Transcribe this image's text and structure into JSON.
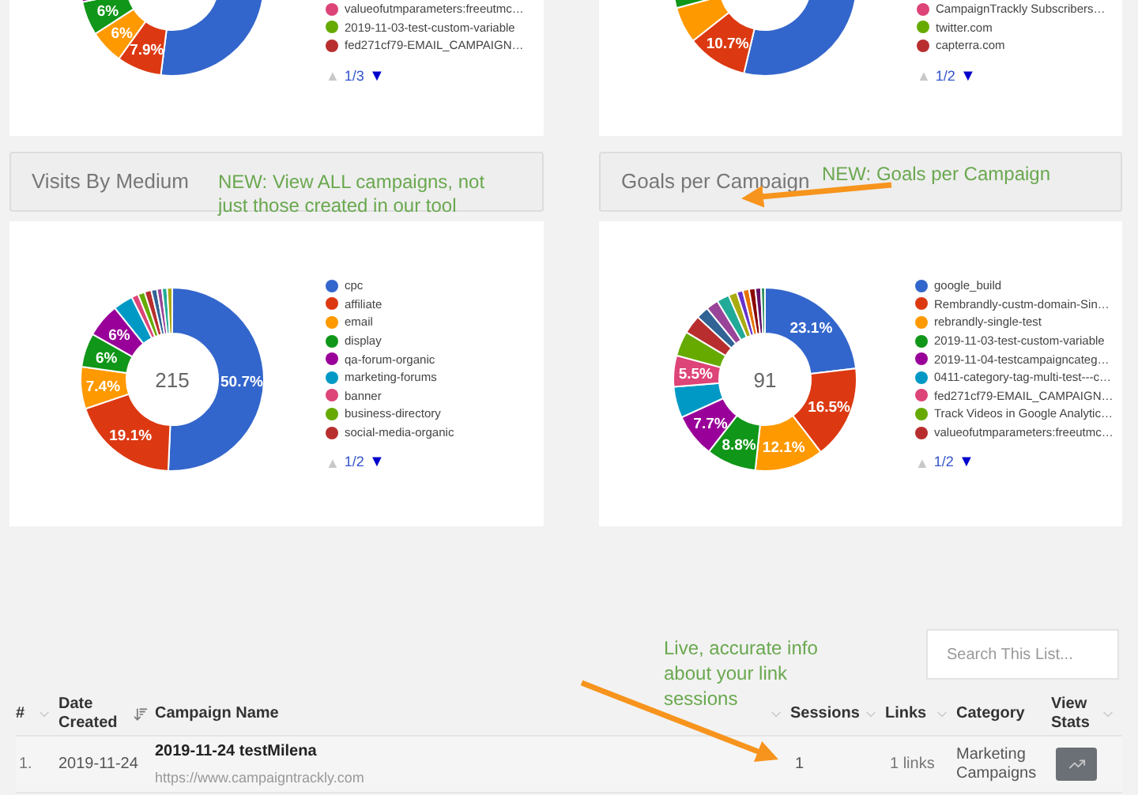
{
  "top_charts": [
    {
      "slice_labels": [
        "6%",
        "6%",
        "7.9%"
      ],
      "legend": [
        {
          "label": "valueofutmparameters:freeutmc…",
          "color": "#dd4477"
        },
        {
          "label": "2019-11-03-test-custom-variable",
          "color": "#66aa00"
        },
        {
          "label": "fed271cf79-EMAIL_CAMPAIGN…",
          "color": "#b82e2e"
        }
      ],
      "pager": {
        "prev": "▲",
        "page": "1/3",
        "next": "▼",
        "prev_disabled": true,
        "next_disabled": false
      }
    },
    {
      "slice_labels": [
        "10.7%"
      ],
      "legend": [
        {
          "label": "CampaignTrackly Subscribers…",
          "color": "#dd4477"
        },
        {
          "label": "twitter.com",
          "color": "#66aa00"
        },
        {
          "label": "capterra.com",
          "color": "#b82e2e"
        }
      ],
      "pager": {
        "prev": "▲",
        "page": "1/2",
        "next": "▼",
        "prev_disabled": true,
        "next_disabled": false
      }
    }
  ],
  "panels": [
    {
      "title": "Visits By Medium",
      "center": "215",
      "slice_labels": [
        "50.7%",
        "19.1%",
        "7.4%",
        "6%",
        "6%"
      ],
      "legend": [
        {
          "label": "cpc",
          "color": "#3366cc"
        },
        {
          "label": "affiliate",
          "color": "#dc3912"
        },
        {
          "label": "email",
          "color": "#ff9900"
        },
        {
          "label": "display",
          "color": "#109618"
        },
        {
          "label": "qa-forum-organic",
          "color": "#990099"
        },
        {
          "label": "marketing-forums",
          "color": "#0099c6"
        },
        {
          "label": "banner",
          "color": "#dd4477"
        },
        {
          "label": "business-directory",
          "color": "#66aa00"
        },
        {
          "label": "social-media-organic",
          "color": "#b82e2e"
        }
      ],
      "pager": {
        "prev": "▲",
        "page": "1/2",
        "next": "▼",
        "prev_disabled": true,
        "next_disabled": false
      }
    },
    {
      "title": "Goals per Campaign",
      "center": "91",
      "slice_labels": [
        "23.1%",
        "16.5%",
        "12.1%",
        "8.8%",
        "7.7%",
        "5.5%"
      ],
      "legend": [
        {
          "label": "google_build",
          "color": "#3366cc"
        },
        {
          "label": "Rembrandly-custm-domain-Sin…",
          "color": "#dc3912"
        },
        {
          "label": "rebrandly-single-test",
          "color": "#ff9900"
        },
        {
          "label": "2019-11-03-test-custom-variable",
          "color": "#109618"
        },
        {
          "label": "2019-11-04-testcampaigncateg…",
          "color": "#990099"
        },
        {
          "label": "0411-category-tag-multi-test---c…",
          "color": "#0099c6"
        },
        {
          "label": "fed271cf79-EMAIL_CAMPAIGN…",
          "color": "#dd4477"
        },
        {
          "label": "Track Videos in Google Analytic…",
          "color": "#66aa00"
        },
        {
          "label": "valueofutmparameters:freeutmc…",
          "color": "#b82e2e"
        }
      ],
      "pager": {
        "prev": "▲",
        "page": "1/2",
        "next": "▼",
        "prev_disabled": true,
        "next_disabled": false
      }
    }
  ],
  "annotations": [
    "NEW: View ALL campaigns, not just those created in our tool",
    "NEW: Goals per Campaign",
    "Live, accurate info about your link sessions"
  ],
  "search": {
    "placeholder": "Search This List..."
  },
  "table": {
    "columns": [
      {
        "label": "#",
        "sortable": true,
        "sorted": false
      },
      {
        "label": "Date Created",
        "sortable": true,
        "sorted": true
      },
      {
        "label": "Campaign Name",
        "sortable": true,
        "sorted": false
      },
      {
        "label": "Sessions",
        "sortable": true,
        "sorted": false
      },
      {
        "label": "Links",
        "sortable": true,
        "sorted": false
      },
      {
        "label": "Category",
        "sortable": false
      },
      {
        "label": "View Stats",
        "sortable": true,
        "sorted": false
      }
    ],
    "rows": [
      {
        "number": "1.",
        "date": "2019-11-24",
        "campaign": "2019-11-24 testMilena",
        "url": "https://www.campaigntrackly.com",
        "sessions": "1",
        "links": "1 links",
        "category": "Marketing Campaigns"
      }
    ]
  }
}
